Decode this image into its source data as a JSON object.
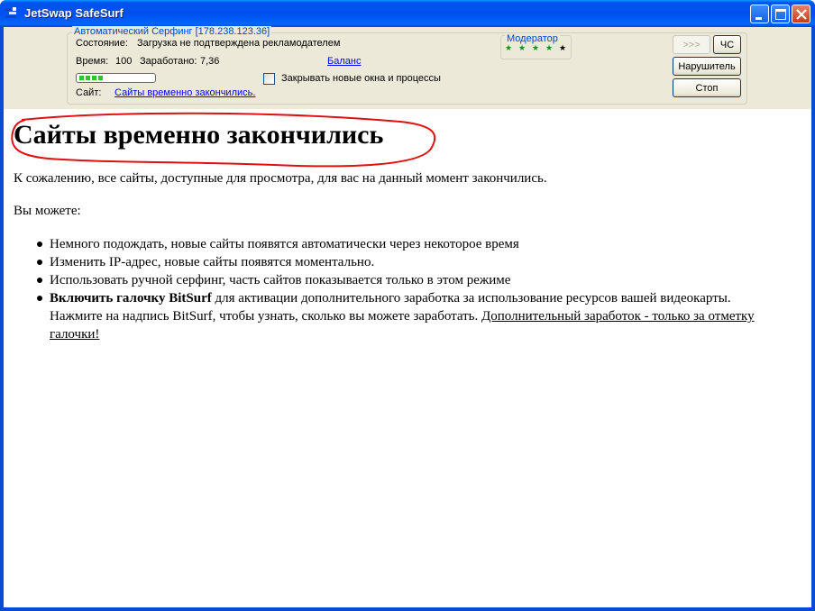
{
  "window": {
    "title": "JetSwap SafeSurf",
    "icon": "jetswap-app-icon",
    "controls": [
      "minimize-icon",
      "maximize-icon",
      "close-icon"
    ]
  },
  "panel": {
    "group_title": "Автоматический Серфинг [178.238.123.36]",
    "status_label": "Состояние:",
    "status_value": "Загрузка не подтверждена рекламодателем",
    "time_label": "Время:",
    "time_value": "100",
    "earned_label": "Заработано:",
    "earned_value": "7,36",
    "balance_link": "Баланс",
    "progress_segments": 4,
    "close_windows_label": "Закрывать новые окна и процессы",
    "close_windows_checked": false,
    "site_label": "Сайт:",
    "site_link": "Сайты временно закончились.",
    "moderator": {
      "title": "Модератор",
      "rating": 4,
      "max_rating": 5,
      "star_glyph": "★"
    },
    "buttons": {
      "next": ">>>",
      "blacklist": "ЧС",
      "violator": "Нарушитель",
      "stop": "Стоп"
    }
  },
  "page": {
    "heading": "Сайты временно закончились",
    "intro": "К сожалению, все сайты, доступные для просмотра, для вас на данный момент закончились.",
    "you_can": "Вы можете:",
    "items": [
      "Немного подождать, новые сайты появятся автоматически через некоторое время",
      "Изменить IP-адрес, новые сайты появятся моментально.",
      "Использовать ручной серфинг, часть сайтов показывается только в этом режиме"
    ],
    "bitsurf": {
      "bold": "Включить галочку BitSurf",
      "rest1": " для активации дополнительного заработка за использование ресурсов вашей видеокарты.",
      "rest2": "Нажмите на надпись BitSurf, чтобы узнать, сколько вы можете заработать. ",
      "link": "Дополнительный заработок - только за отметку галочки!"
    }
  },
  "colors": {
    "title_blue": "#0050ee",
    "link_blue": "#0000ff",
    "group_title_blue": "#0046d5",
    "panel_bg": "#ece9d8",
    "progress_green": "#2fc42f",
    "star_green": "#1e8a1e",
    "annotation_red": "#e01010"
  }
}
